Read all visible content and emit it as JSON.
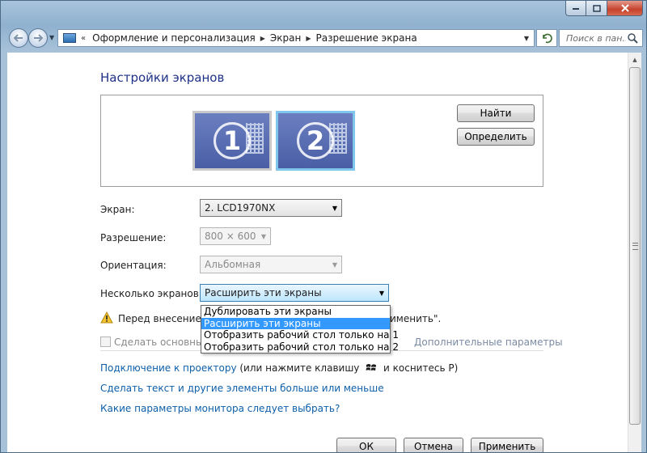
{
  "navbar": {
    "breadcrumb": [
      "Оформление и персонализация",
      "Экран",
      "Разрешение экрана"
    ],
    "search_placeholder": "Поиск в пан..."
  },
  "page": {
    "title": "Настройки экранов"
  },
  "monitors": [
    {
      "number": "1",
      "selected": false
    },
    {
      "number": "2",
      "selected": true
    }
  ],
  "buttons": {
    "find": "Найти",
    "identify": "Определить",
    "ok": "ОК",
    "cancel": "Отмена",
    "apply": "Применить"
  },
  "form": {
    "screen_label": "Экран:",
    "screen_value": "2. LCD1970NX",
    "resolution_label": "Разрешение:",
    "resolution_value": "800 × 600",
    "orientation_label": "Ориентация:",
    "orientation_value": "Альбомная",
    "multiple_label": "Несколько экранов:",
    "multiple_value": "Расширить эти экраны"
  },
  "multiple_options": [
    "Дублировать эти экраны",
    "Расширить эти экраны",
    "Отобразить рабочий стол только на 1",
    "Отобразить рабочий стол только на 2"
  ],
  "selected_option_index": 1,
  "warning": {
    "text_visible_left": "Перед внесением",
    "text_visible_right": "именить\"."
  },
  "checkbox": {
    "label_visible": "Сделать основным",
    "checked": false
  },
  "advanced_link": "Дополнительные параметры",
  "links": {
    "projector": "Подключение к проектору",
    "projector_hint_before": " (или нажмите клавишу ",
    "projector_hint_after": " и коснитесь P)",
    "text_size": "Сделать текст и другие элементы больше или меньше",
    "monitor_params": "Какие параметры монитора следует выбрать?"
  },
  "colors": {
    "title_blue": "#1e3287",
    "link_blue": "#0e5fa8",
    "selection_blue": "#3399ff",
    "monitor_highlight": "#7fc6ec"
  }
}
